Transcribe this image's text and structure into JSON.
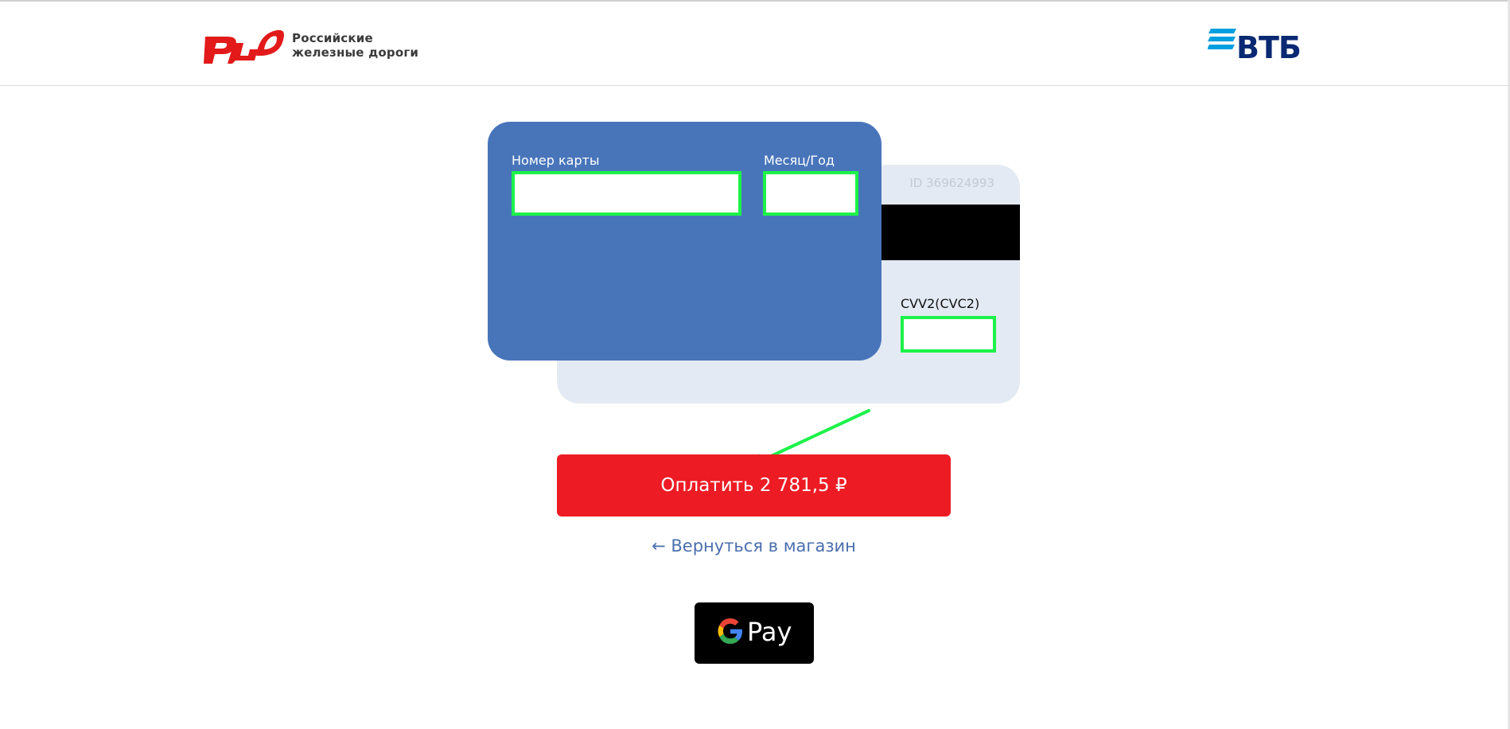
{
  "header": {
    "rzd_logo_line1": "Российские",
    "rzd_logo_line2": "железные дороги",
    "vtb_logo": "ВТБ"
  },
  "card": {
    "id_text": "ID 369624993",
    "pan_label": "Номер карты",
    "pan_value": "",
    "expiry_label": "Месяц/Год",
    "expiry_value": "",
    "cvv_label": "CVV2(CVC2)",
    "cvv_value": ""
  },
  "actions": {
    "pay_label": "Оплатить 2 781,5 ₽",
    "back_label": "← Вернуться в магазин",
    "gpay_label": "Pay"
  },
  "colors": {
    "card_front": "#4875ba",
    "card_back": "#e3eaf3",
    "pay_button": "#ed1c24",
    "highlight": "#1df249",
    "link": "#4a6fae",
    "rzd_red": "#e21a1a",
    "vtb_blue": "#0a2973",
    "vtb_stripes": "#009fdf"
  },
  "icons": {
    "rzd": "rzd-logo-icon",
    "vtb": "vtb-stripes-icon",
    "google": "google-g-icon",
    "arrow": "annotation-arrow"
  }
}
